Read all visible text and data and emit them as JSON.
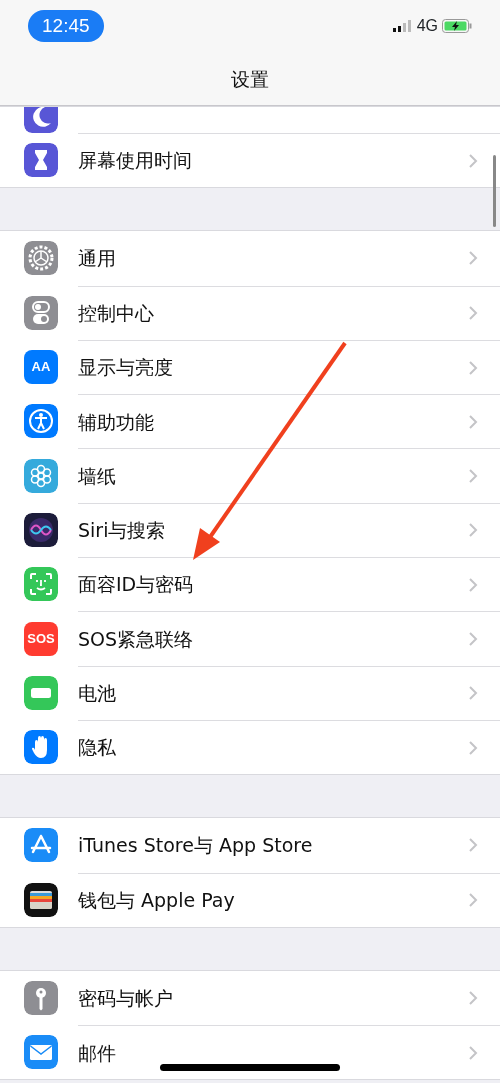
{
  "status_bar": {
    "time": "12:45",
    "network": "4G"
  },
  "title": "设置",
  "sections": [
    {
      "items": [
        {
          "cut_off": true
        },
        {
          "label": "屏幕使用时间"
        }
      ]
    },
    {
      "items": [
        {
          "label": "通用"
        },
        {
          "label": "控制中心"
        },
        {
          "label": "显示与亮度",
          "icon_text": "AA"
        },
        {
          "label": "辅助功能"
        },
        {
          "label": "墙纸"
        },
        {
          "label": "Siri与搜索"
        },
        {
          "label": "面容ID与密码"
        },
        {
          "label": "SOS紧急联络",
          "icon_text": "SOS"
        },
        {
          "label": "电池"
        },
        {
          "label": "隐私"
        }
      ]
    },
    {
      "items": [
        {
          "label": "iTunes Store与 App Store"
        },
        {
          "label": "钱包与 Apple Pay"
        }
      ]
    },
    {
      "items": [
        {
          "label": "密码与帐户"
        },
        {
          "label": "邮件"
        }
      ]
    }
  ]
}
